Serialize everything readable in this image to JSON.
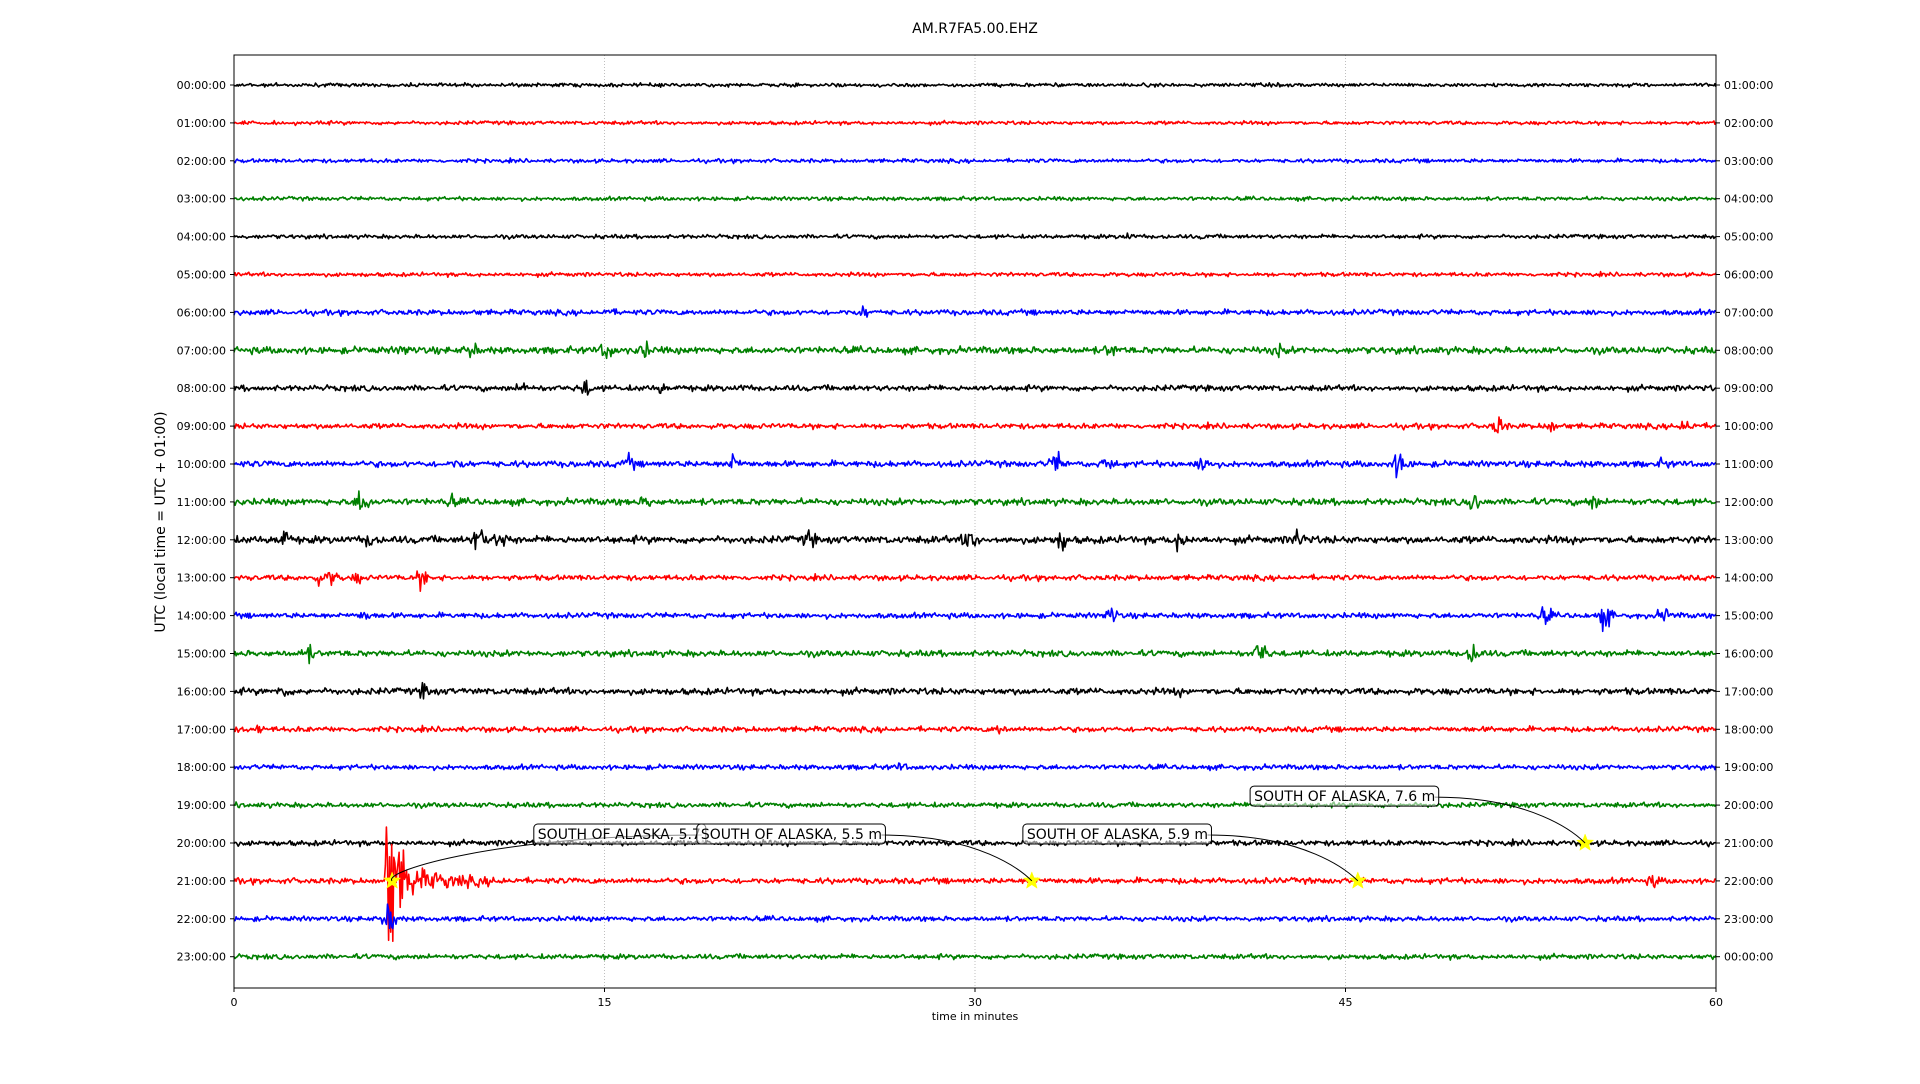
{
  "chart_data": {
    "type": "line",
    "title": "AM.R7FA5.00.EHZ",
    "xlabel": "time in minutes",
    "ylabel": "UTC (local time = UTC + 01:00)",
    "xlim": [
      0,
      60
    ],
    "x_ticks": [
      "0",
      "15",
      "30",
      "45",
      "60"
    ],
    "x_tick_values": [
      0,
      15,
      30,
      45,
      60
    ],
    "grid": "vertical dotted at 15, 30, 45",
    "colors": [
      "#000000",
      "#ff0000",
      "#0000ff",
      "#008000"
    ],
    "rows": [
      {
        "utc": "00:00:00",
        "local": "01:00:00",
        "activity": 0.25
      },
      {
        "utc": "01:00:00",
        "local": "02:00:00",
        "activity": 0.25
      },
      {
        "utc": "02:00:00",
        "local": "03:00:00",
        "activity": 0.3
      },
      {
        "utc": "03:00:00",
        "local": "04:00:00",
        "activity": 0.3
      },
      {
        "utc": "04:00:00",
        "local": "05:00:00",
        "activity": 0.35
      },
      {
        "utc": "05:00:00",
        "local": "06:00:00",
        "activity": 0.35
      },
      {
        "utc": "06:00:00",
        "local": "07:00:00",
        "activity": 0.7
      },
      {
        "utc": "07:00:00",
        "local": "08:00:00",
        "activity": 1.1
      },
      {
        "utc": "08:00:00",
        "local": "09:00:00",
        "activity": 0.8
      },
      {
        "utc": "09:00:00",
        "local": "10:00:00",
        "activity": 0.7
      },
      {
        "utc": "10:00:00",
        "local": "11:00:00",
        "activity": 0.9
      },
      {
        "utc": "11:00:00",
        "local": "12:00:00",
        "activity": 1.0
      },
      {
        "utc": "12:00:00",
        "local": "13:00:00",
        "activity": 1.2
      },
      {
        "utc": "13:00:00",
        "local": "14:00:00",
        "activity": 0.7
      },
      {
        "utc": "14:00:00",
        "local": "15:00:00",
        "activity": 0.7
      },
      {
        "utc": "15:00:00",
        "local": "16:00:00",
        "activity": 0.9
      },
      {
        "utc": "16:00:00",
        "local": "17:00:00",
        "activity": 1.0
      },
      {
        "utc": "17:00:00",
        "local": "18:00:00",
        "activity": 0.7
      },
      {
        "utc": "18:00:00",
        "local": "19:00:00",
        "activity": 0.6
      },
      {
        "utc": "19:00:00",
        "local": "20:00:00",
        "activity": 0.6
      },
      {
        "utc": "20:00:00",
        "local": "21:00:00",
        "activity": 0.7
      },
      {
        "utc": "21:00:00",
        "local": "22:00:00",
        "activity": 0.8
      },
      {
        "utc": "22:00:00",
        "local": "23:00:00",
        "activity": 0.6
      },
      {
        "utc": "23:00:00",
        "local": "00:00:00",
        "activity": 0.6
      }
    ],
    "bursts": [
      {
        "row": 4,
        "x": 36.2,
        "amp": 8
      },
      {
        "row": 4,
        "x": 39.3,
        "amp": 6
      },
      {
        "row": 6,
        "x": 15.2,
        "amp": 10
      },
      {
        "row": 6,
        "x": 25.5,
        "amp": 14
      },
      {
        "row": 6,
        "x": 55.2,
        "amp": 8
      },
      {
        "row": 7,
        "x": 6.9,
        "amp": 14
      },
      {
        "row": 7,
        "x": 9.6,
        "amp": 18
      },
      {
        "row": 7,
        "x": 15.1,
        "amp": 20
      },
      {
        "row": 7,
        "x": 16.6,
        "amp": 18
      },
      {
        "row": 7,
        "x": 35.5,
        "amp": 16
      },
      {
        "row": 7,
        "x": 42.3,
        "amp": 14
      },
      {
        "row": 8,
        "x": 11.7,
        "amp": 14
      },
      {
        "row": 8,
        "x": 14.2,
        "amp": 18
      },
      {
        "row": 8,
        "x": 17.3,
        "amp": 12
      },
      {
        "row": 8,
        "x": 20.6,
        "amp": 8
      },
      {
        "row": 9,
        "x": 51.2,
        "amp": 20
      },
      {
        "row": 9,
        "x": 53.3,
        "amp": 14
      },
      {
        "row": 9,
        "x": 58.8,
        "amp": 18
      },
      {
        "row": 10,
        "x": 9.1,
        "amp": 12
      },
      {
        "row": 10,
        "x": 16.0,
        "amp": 16
      },
      {
        "row": 10,
        "x": 20.2,
        "amp": 20
      },
      {
        "row": 10,
        "x": 33.3,
        "amp": 22
      },
      {
        "row": 10,
        "x": 35.4,
        "amp": 18
      },
      {
        "row": 10,
        "x": 39.3,
        "amp": 22
      },
      {
        "row": 10,
        "x": 47.2,
        "amp": 28
      },
      {
        "row": 10,
        "x": 57.9,
        "amp": 12
      },
      {
        "row": 11,
        "x": 5.2,
        "amp": 28
      },
      {
        "row": 11,
        "x": 8.8,
        "amp": 14
      },
      {
        "row": 11,
        "x": 16.7,
        "amp": 14
      },
      {
        "row": 11,
        "x": 50.2,
        "amp": 22
      },
      {
        "row": 11,
        "x": 55.0,
        "amp": 18
      },
      {
        "row": 12,
        "x": 2.0,
        "amp": 22
      },
      {
        "row": 12,
        "x": 5.5,
        "amp": 18
      },
      {
        "row": 12,
        "x": 9.9,
        "amp": 28
      },
      {
        "row": 12,
        "x": 10.8,
        "amp": 22
      },
      {
        "row": 12,
        "x": 23.3,
        "amp": 18
      },
      {
        "row": 12,
        "x": 29.8,
        "amp": 26
      },
      {
        "row": 12,
        "x": 33.5,
        "amp": 22
      },
      {
        "row": 12,
        "x": 38.3,
        "amp": 24
      },
      {
        "row": 12,
        "x": 43.1,
        "amp": 22
      },
      {
        "row": 13,
        "x": 3.4,
        "amp": 14
      },
      {
        "row": 13,
        "x": 4.0,
        "amp": 18
      },
      {
        "row": 13,
        "x": 5.0,
        "amp": 12
      },
      {
        "row": 13,
        "x": 7.6,
        "amp": 20
      },
      {
        "row": 14,
        "x": 5.3,
        "amp": 12
      },
      {
        "row": 14,
        "x": 35.5,
        "amp": 18
      },
      {
        "row": 14,
        "x": 53.1,
        "amp": 18
      },
      {
        "row": 14,
        "x": 55.5,
        "amp": 24
      },
      {
        "row": 14,
        "x": 57.9,
        "amp": 16
      },
      {
        "row": 15,
        "x": 3.0,
        "amp": 18
      },
      {
        "row": 15,
        "x": 41.6,
        "amp": 26
      },
      {
        "row": 15,
        "x": 50.2,
        "amp": 22
      },
      {
        "row": 16,
        "x": 2.0,
        "amp": 14
      },
      {
        "row": 16,
        "x": 7.7,
        "amp": 16
      },
      {
        "row": 16,
        "x": 38.2,
        "amp": 10
      },
      {
        "row": 17,
        "x": 1.0,
        "amp": 10
      },
      {
        "row": 17,
        "x": 31.0,
        "amp": 12
      },
      {
        "row": 18,
        "x": 27.0,
        "amp": 10
      },
      {
        "row": 21,
        "x": 57.5,
        "amp": 14
      },
      {
        "row": 22,
        "x": 6.3,
        "amp": 30
      }
    ],
    "big_quake": {
      "row": 21,
      "x_start": 6.1,
      "peak_amp": 240,
      "decay_minutes": 3.5
    },
    "annotations": [
      {
        "label": "SOUTH OF ALASKA, 5.7",
        "row": 21,
        "x": 6.4,
        "text_x": 12.3,
        "text_row": 20
      },
      {
        "label": "SOUTH OF ALASKA, 5.5 m",
        "row": 21,
        "x": 32.3,
        "text_x": 18.9,
        "text_row": 20
      },
      {
        "label": "SOUTH OF ALASKA, 5.9 m",
        "row": 21,
        "x": 45.5,
        "text_x": 32.1,
        "text_row": 20
      },
      {
        "label": "SOUTH OF ALASKA, 7.6 m",
        "row": 20,
        "x": 54.7,
        "text_x": 41.3,
        "text_row": 19
      }
    ],
    "marker_color": "#ffff00"
  }
}
